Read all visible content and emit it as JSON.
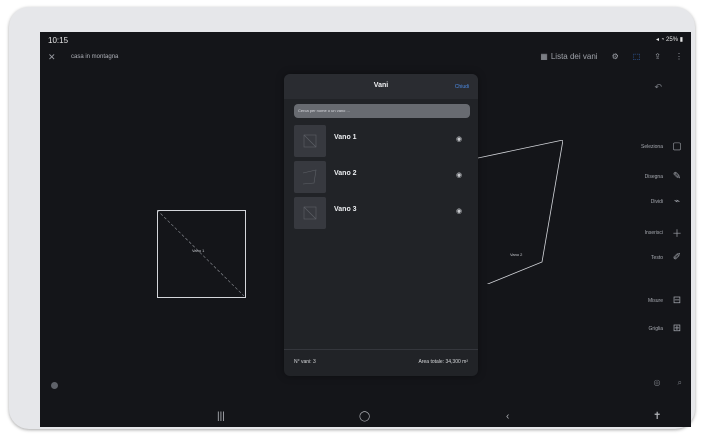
{
  "status": {
    "time": "10:15",
    "battery": "25%"
  },
  "topbar": {
    "title": "casa in montagna",
    "list_button": "Lista dei vani"
  },
  "modal": {
    "title": "Vani",
    "close_label": "Chiudi",
    "search_placeholder": "Cerca per nome o un vano ...",
    "rooms": [
      {
        "name": "Vano 1"
      },
      {
        "name": "Vano 2"
      },
      {
        "name": "Vano 3"
      }
    ],
    "footer_count": "N° vani: 3",
    "footer_total": "Area totale: 34,300 m²"
  },
  "tools": [
    {
      "label": "Seleziona",
      "icon": "select-icon"
    },
    {
      "label": "Disegna",
      "icon": "draw-icon"
    },
    {
      "label": "Dividi",
      "icon": "split-icon"
    },
    {
      "label": "Inserisci",
      "icon": "insert-icon"
    },
    {
      "label": "Testo",
      "icon": "text-icon"
    },
    {
      "label": "Misure",
      "icon": "measure-icon"
    },
    {
      "label": "Griglia",
      "icon": "grid-icon"
    }
  ],
  "canvas": {
    "room1_label": "Vano 1",
    "room2_label": "Vano 2"
  },
  "colors": {
    "accent": "#3d7bd9",
    "background": "#141519",
    "modal": "#212327"
  }
}
